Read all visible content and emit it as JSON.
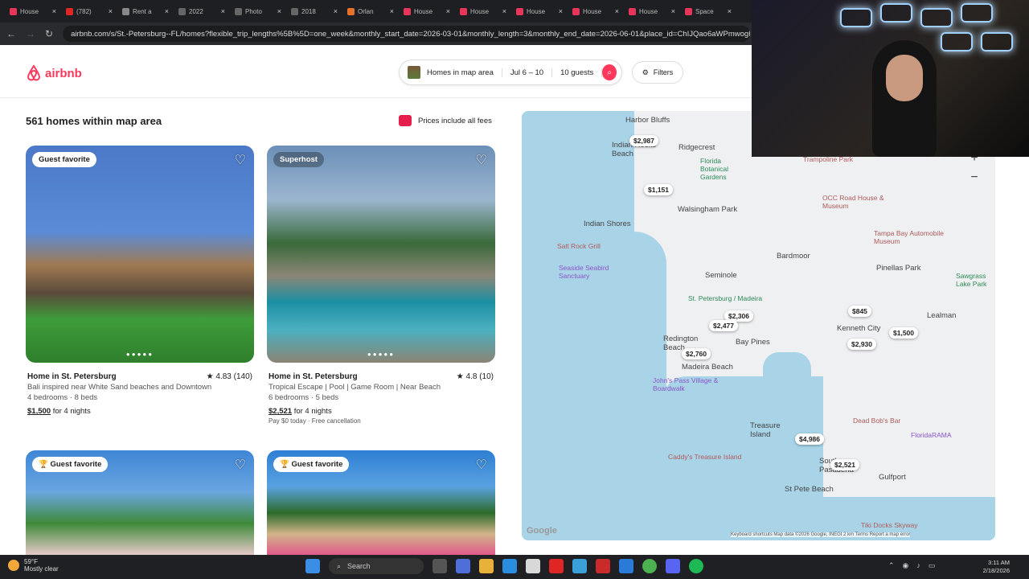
{
  "browser": {
    "tabs": [
      {
        "label": "House",
        "color": "#e8365a"
      },
      {
        "label": "(782)",
        "color": "#e02525"
      },
      {
        "label": "Rent a",
        "color": "#888888"
      },
      {
        "label": "2022",
        "color": "#666666"
      },
      {
        "label": "Photo",
        "color": "#666666"
      },
      {
        "label": "2018",
        "color": "#666666"
      },
      {
        "label": "Orlan",
        "color": "#e8712a"
      },
      {
        "label": "House",
        "color": "#e8365a"
      },
      {
        "label": "House",
        "color": "#e8365a"
      },
      {
        "label": "House",
        "color": "#e8365a"
      },
      {
        "label": "House",
        "color": "#e8365a"
      },
      {
        "label": "House",
        "color": "#e8365a"
      },
      {
        "label": "Space",
        "color": "#e8365a"
      }
    ],
    "url": "airbnb.com/s/St.-Petersburg--FL/homes?flexible_trip_lengths%5B%5D=one_week&monthly_start_date=2026-03-01&monthly_length=3&monthly_end_date=2026-06-01&place_id=ChIJQao6aWPmwogR"
  },
  "header": {
    "logo_text": "airbnb",
    "search_location": "Homes in map area",
    "search_dates": "Jul 6 – 10",
    "search_guests": "10 guests",
    "filters_label": "Filters"
  },
  "results": {
    "count_label": "561 homes within map area",
    "fees_label": "Prices include all fees"
  },
  "listings": [
    {
      "badge": "Guest favorite",
      "title": "Home in St. Petersburg",
      "rating": "★ 4.83 (140)",
      "desc": "Bali inspired near White Sand beaches and Downtown",
      "beds": "4 bedrooms · 8 beds",
      "price": "$1,500",
      "price_suffix": " for 4 nights",
      "note": ""
    },
    {
      "badge": "Superhost",
      "title": "Home in St. Petersburg",
      "rating": "★ 4.8 (10)",
      "desc": "Tropical Escape | Pool | Game Room | Near Beach",
      "beds": "6 bedrooms · 5 beds",
      "price": "$2,521",
      "price_suffix": " for 4 nights",
      "note": "Pay $0 today · Free cancellation"
    },
    {
      "badge": "Guest favorite"
    },
    {
      "badge": "Guest favorite"
    }
  ],
  "map": {
    "places": [
      "Harbor Bluffs",
      "Indian Rocks Beach",
      "Ridgecrest",
      "Walsingham Park",
      "Indian Shores",
      "Seminole",
      "Bardmoor",
      "Pinellas Park",
      "Lealman",
      "Kenneth City",
      "St. Petersburg / Madeira",
      "Redington Beach",
      "Bay Pines",
      "Madeira Beach",
      "Treasure Island",
      "South Pasadena",
      "St Pete Beach",
      "Gulfport",
      "Sawgrass Lake Park",
      "Florida Botanical Gardens"
    ],
    "pois": [
      "Salt Rock Grill",
      "Seaside Seabird Sanctuary",
      "John's Pass Village & Boardwalk",
      "Caddy's Treasure Island",
      "Dead Bob's Bar",
      "FloridaRAMA",
      "Tiki Docks Skyway",
      "OCC Road House & Museum",
      "Tampa Bay Automobile Museum",
      "Trampoline Park"
    ],
    "prices": [
      "$2,987",
      "$1,151",
      "$845",
      "$1,500",
      "$2,306",
      "$2,477",
      "$2,930",
      "$2,760",
      "$4,986",
      "$2,521"
    ],
    "attribution": "Keyboard shortcuts   Map data ©2026 Google, INEGI   2 km   Terms   Report a map error",
    "google_label": "Google",
    "zoom_in": "+",
    "zoom_out": "−"
  },
  "taskbar": {
    "temp": "59°F",
    "weather": "Mostly clear",
    "search_label": "Search",
    "time": "3:11 AM",
    "date": "2/18/2026"
  }
}
